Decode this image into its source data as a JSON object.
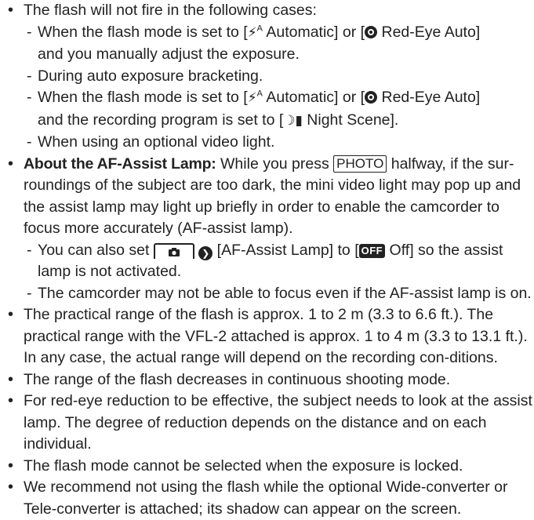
{
  "notes": {
    "b1": {
      "intro": "The flash will not fire in the following cases:",
      "sub1": {
        "pre": "When the flash mode is set to [",
        "auto_label": "Automatic] or [",
        "redeye_label": "Red-Eye Auto]",
        "line2": "and you manually adjust the exposure."
      },
      "sub2": "During auto exposure bracketing.",
      "sub3": {
        "pre": "When the flash mode is set to [",
        "auto_label": "Automatic] or [",
        "redeye_label": "Red-Eye Auto]",
        "line2_pre": "and the recording program is set to [",
        "night_label": "Night Scene]."
      },
      "sub4": "When using an optional video light."
    },
    "b2": {
      "title": "About the AF-Assist Lamp:",
      "t1": " While you press ",
      "photo_key": "PHOTO",
      "t2": " halfway, if the sur-roundings of the subject are too dark, the mini video light may pop up and the assist lamp may light up briefly in order to enable the camcorder to focus more accurately (AF-assist lamp).",
      "sub1_pre": "You can also set ",
      "sub1_mid": " [AF-Assist Lamp] to [",
      "off_badge": "OFF",
      "sub1_post": " Off] so the assist lamp is not activated.",
      "sub2": "The camcorder may not be able to focus even if the AF-assist lamp is on."
    },
    "b3": "The practical range of the flash is approx. 1 to 2 m (3.3 to 6.6 ft.). The practical range with the VFL-2 attached is approx. 1 to 4 m (3.3 to 13.1 ft.). In any case, the actual range will depend on the recording con-ditions.",
    "b4": "The range of the flash decreases in continuous shooting mode.",
    "b5": "For red-eye reduction to be effective, the subject needs to look at the assist lamp. The degree of reduction depends on the distance and on each individual.",
    "b6": "The flash mode cannot be selected when the exposure is locked.",
    "b7": "We recommend not using the flash while the optional Wide-converter or Tele-converter is attached; its shadow can appear on the screen."
  },
  "icons": {
    "flash_auto": "flash-auto-icon",
    "red_eye": "red-eye-icon",
    "night_scene": "night-scene-icon",
    "camera_tab": "camera-menu-icon",
    "menu_arrow": "menu-arrow-icon"
  }
}
